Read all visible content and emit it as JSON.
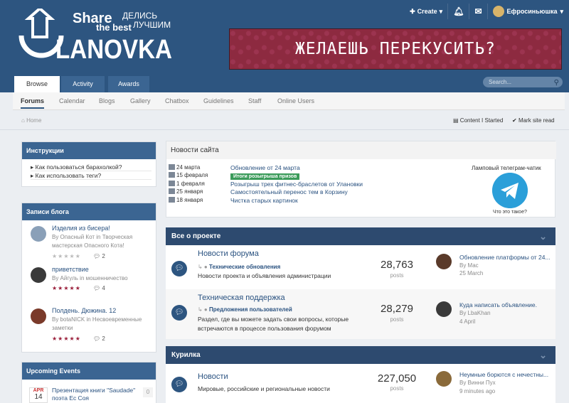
{
  "userbar": {
    "create": "Create",
    "username": "Ефросиньюшка"
  },
  "logo": {
    "share": "Share",
    "the_best": "the best",
    "delis": "ДЕЛИСЬ",
    "luchshim": "ЛУЧШИМ",
    "brand": "LANOVKA"
  },
  "banner": {
    "text": "ЖЕЛАЕШЬ ПЕРЕКУСИТЬ?"
  },
  "tabs": [
    {
      "label": "Browse"
    },
    {
      "label": "Activity"
    },
    {
      "label": "Awards"
    }
  ],
  "search": {
    "placeholder": "Search..."
  },
  "subnav": [
    {
      "label": "Forums"
    },
    {
      "label": "Calendar"
    },
    {
      "label": "Blogs"
    },
    {
      "label": "Gallery"
    },
    {
      "label": "Chatbox"
    },
    {
      "label": "Guidelines"
    },
    {
      "label": "Staff"
    },
    {
      "label": "Online Users"
    }
  ],
  "breadcrumb": {
    "home": "Home",
    "content_started": "Content I Started",
    "mark_read": "Mark site read"
  },
  "instructions": {
    "title": "Инструкции",
    "items": [
      "Как пользоваться барахолкой?",
      "Как использовать теги?"
    ]
  },
  "blog": {
    "title": "Записи блога",
    "entries": [
      {
        "title": "Изделия из бисера!",
        "by": "By Опасный Кот in Творческая мастерская Опасного Кота!",
        "comments": "2",
        "rating": 0
      },
      {
        "title": "приветствие",
        "by": "By Айгуль in мошенничество",
        "comments": "4",
        "rating": 5
      },
      {
        "title": "Полдень. Дюжина. 12",
        "by": "By botaNICK in Несвоевременные заметки",
        "comments": "2",
        "rating": 5
      }
    ]
  },
  "events": {
    "title": "Upcoming Events",
    "month": "APR",
    "day": "14",
    "item": "Презентация книги \"Saudade\" поэта Ес Соя",
    "count": "0"
  },
  "news": {
    "title": "Новости сайта",
    "items": [
      {
        "date": "24 марта",
        "text": "Обновление от 24 марта",
        "badge": ""
      },
      {
        "date": "15 февраля",
        "text": "",
        "badge": "Итоги розыгрыша призов"
      },
      {
        "date": "1 февраля",
        "text": "Розыгрыш трех фитнес-браслетов от Улановки",
        "badge": ""
      },
      {
        "date": "25 января",
        "text": "Самостоятельный перенос тем в Корзину",
        "badge": ""
      },
      {
        "date": "18 января",
        "text": "Чистка старых картинок",
        "badge": ""
      }
    ],
    "telegram_title": "Ламповый телеграм-чатик",
    "telegram_q": "Что это такое?"
  },
  "categories": [
    {
      "title": "Все о проекте"
    },
    {
      "title": "Курилка"
    }
  ],
  "forums": [
    {
      "title": "Новости форума",
      "sub": "Технические обновления",
      "desc": "Новости проекта и объявления администрации",
      "count": "28,763",
      "posts_label": "posts",
      "last_title": "Обновление платформы от 24...",
      "last_by": "By Mac",
      "last_date": "25 March"
    },
    {
      "title": "Техническая поддержка",
      "sub": "Предложения пользователей",
      "desc": "Раздел, где вы можете задать свои вопросы, которые встречаются в процессе пользования форумом",
      "count": "28,279",
      "posts_label": "posts",
      "last_title": "Куда написать объявление.",
      "last_by": "By LbaKhan",
      "last_date": "4 April"
    },
    {
      "title": "Новости",
      "sub": "",
      "desc": "Мировые, российские и региональные новости",
      "count": "227,050",
      "posts_label": "posts",
      "last_title": "Неумные борются с нечестны...",
      "last_by": "By Винни Пух",
      "last_date": "9 minutes ago"
    }
  ]
}
